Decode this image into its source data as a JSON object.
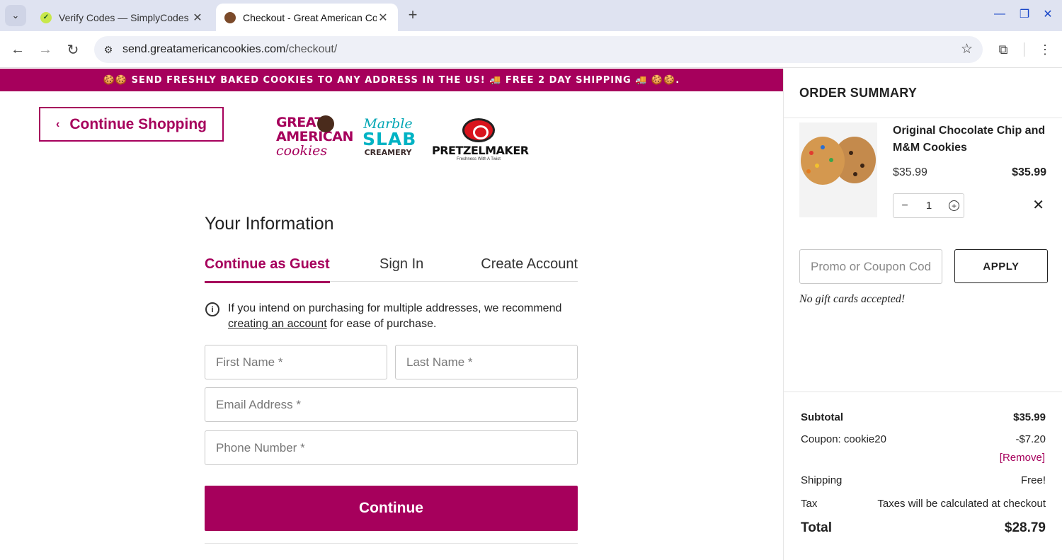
{
  "browser": {
    "tabs": [
      {
        "title": "Verify Codes — SimplyCodes",
        "active": false,
        "favicon": "simplycodes-icon"
      },
      {
        "title": "Checkout - Great American Cookies",
        "active": true,
        "favicon": "cookie-icon"
      }
    ],
    "url_host": "send.greatamericancookies.com",
    "url_path": "/checkout/"
  },
  "banner": {
    "text": "🍪🍪 SEND FRESHLY BAKED COOKIES TO ANY ADDRESS IN THE US! 🚚 FREE 2 DAY SHIPPING 🚚 🍪🍪."
  },
  "header": {
    "continue_shopping_label": "Continue Shopping",
    "logos": {
      "gac": {
        "line1": "GREAT",
        "line2": "AMERICAN",
        "line3": "cookies"
      },
      "marble_slab": {
        "line1": "Marble",
        "line2": "SLAB",
        "line3": "CREAMERY"
      },
      "pretzelmaker": {
        "name": "PRETZELMAKER",
        "tagline": "Freshness With A Twist"
      }
    }
  },
  "form": {
    "title": "Your Information",
    "tabs": [
      "Continue as Guest",
      "Sign In",
      "Create Account"
    ],
    "note_before": "If you intend on purchasing for multiple addresses, we recommend ",
    "note_link": "creating an account",
    "note_after": " for ease of purchase.",
    "placeholders": {
      "first_name": "First Name *",
      "last_name": "Last Name *",
      "email": "Email Address *",
      "phone": "Phone Number *"
    },
    "continue_label": "Continue"
  },
  "summary": {
    "title": "ORDER SUMMARY",
    "item": {
      "name": "Original Chocolate Chip and M&M Cookies",
      "unit_price": "$35.99",
      "line_total": "$35.99",
      "quantity": "1"
    },
    "promo_placeholder": "Promo or Coupon Code",
    "apply_label": "APPLY",
    "gift_note": "No gift cards accepted!",
    "subtotal_label": "Subtotal",
    "subtotal_value": "$35.99",
    "coupon_label": "Coupon: cookie20",
    "coupon_value": "-$7.20",
    "remove_label": "[Remove]",
    "shipping_label": "Shipping",
    "shipping_value": "Free!",
    "tax_label": "Tax",
    "tax_value": "Taxes will be calculated at checkout",
    "total_label": "Total",
    "total_value": "$28.79"
  },
  "colors": {
    "brand": "#a6005c",
    "tabbar": "#dfe3f1"
  }
}
